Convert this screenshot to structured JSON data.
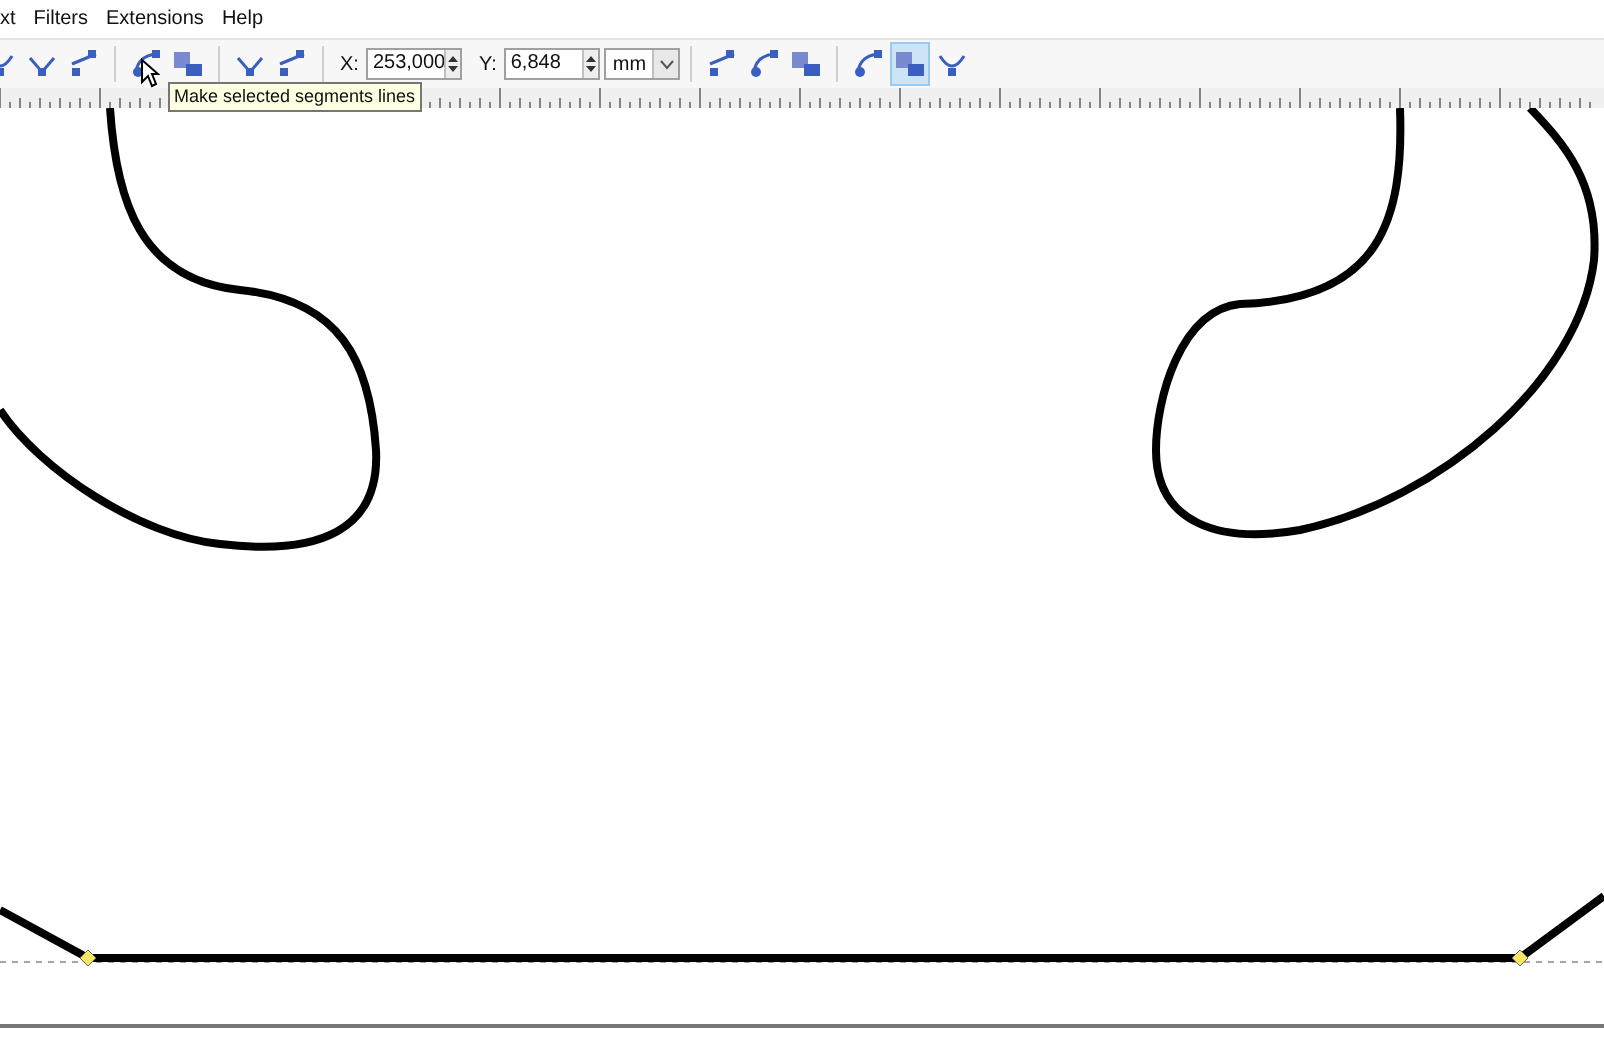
{
  "menu": [
    "xt",
    "Filters",
    "Extensions",
    "Help"
  ],
  "toolbar": {
    "groups": [
      [
        {
          "selected": false
        },
        {
          "selected": false
        },
        {
          "selected": false
        }
      ],
      [
        {
          "selected": false
        },
        {
          "selected": false
        }
      ],
      [
        {
          "selected": false
        },
        {
          "selected": false
        }
      ]
    ],
    "x_label": "X:",
    "x_value": "253,000",
    "y_label": "Y:",
    "y_value": "6,848",
    "unit": "mm",
    "groups2": [
      [
        {
          "selected": false
        },
        {
          "selected": false
        },
        {
          "selected": false
        }
      ],
      [
        {
          "selected": false
        },
        {
          "selected": true
        },
        {
          "selected": false
        }
      ]
    ]
  },
  "tooltip": "Make selected segments lines"
}
